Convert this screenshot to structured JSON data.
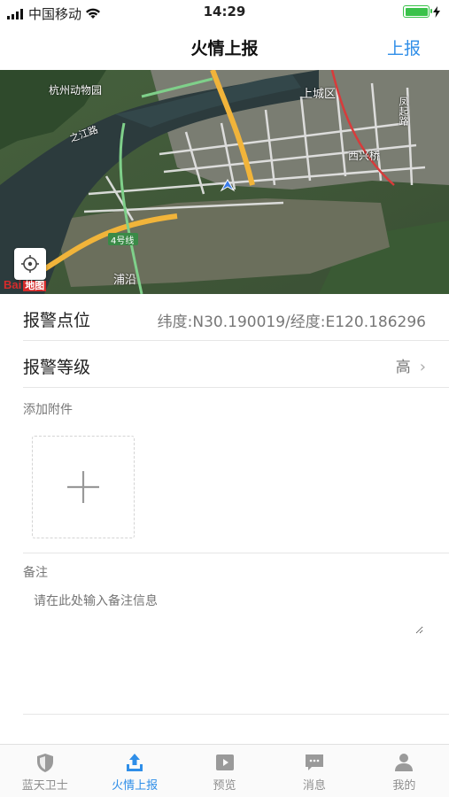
{
  "status_bar": {
    "carrier": "中国移动",
    "time": "14:29"
  },
  "nav": {
    "title": "火情上报",
    "action": "上报"
  },
  "map": {
    "labels": [
      "杭州动物园",
      "之江路",
      "上城区",
      "凤起路",
      "西兴桥",
      "4号线",
      "浦沿"
    ],
    "logo_text": "Bai",
    "logo_badge": "地图"
  },
  "form": {
    "alarm_location_label": "报警点位",
    "alarm_location_value": "纬度:N30.190019/经度:E120.186296",
    "alarm_level_label": "报警等级",
    "alarm_level_value": "高",
    "attachment_label": "添加附件",
    "remark_label": "备注",
    "remark_placeholder": "请在此处输入备注信息"
  },
  "tabs": [
    {
      "label": "蓝天卫士",
      "icon": "shield-icon",
      "active": false
    },
    {
      "label": "火情上报",
      "icon": "upload-icon",
      "active": true
    },
    {
      "label": "预览",
      "icon": "play-icon",
      "active": false
    },
    {
      "label": "消息",
      "icon": "message-icon",
      "active": false
    },
    {
      "label": "我的",
      "icon": "person-icon",
      "active": false
    }
  ],
  "colors": {
    "accent": "#2f8ee8",
    "battery": "#3ac24a"
  }
}
